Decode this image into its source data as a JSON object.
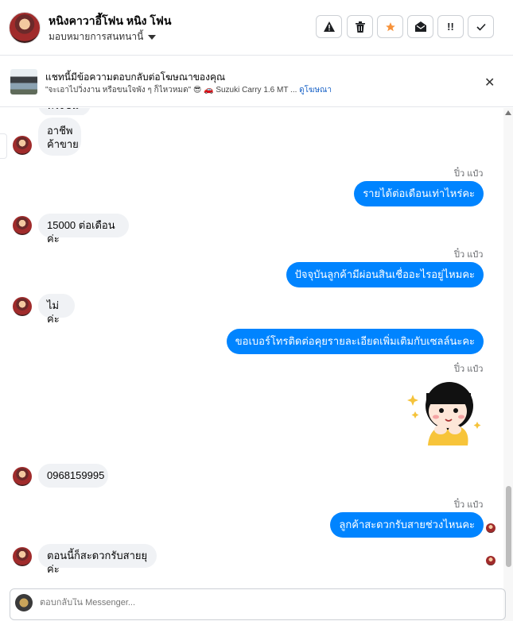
{
  "header": {
    "contact_name": "หนิงคาวาอี้โฟน หนิง โฟน",
    "assign_label": "มอบหมายการสนทนานี้",
    "tools": [
      {
        "icon": "warning-icon",
        "glyph": "⚠"
      },
      {
        "icon": "trash-icon",
        "glyph": "🗑"
      },
      {
        "icon": "star-icon",
        "glyph": "★"
      },
      {
        "icon": "envelope-open-icon",
        "glyph": "✉"
      },
      {
        "icon": "follow-up-icon",
        "glyph": "!!"
      },
      {
        "icon": "check-icon",
        "glyph": "✓"
      }
    ]
  },
  "ad_reply": {
    "title": "แชทนี้มีข้อความตอบกลับต่อโฆษณาของคุณ",
    "subtitle": "\"จะเอาไปวิ่งงาน หรือขนใจพัง ๆ ก็ไหวหมด\" 😎 🚗 Suzuki Carry 1.6 MT ...",
    "link": "ดูโฆษณา"
  },
  "messages": {
    "m_partial": "ทรงชนิ",
    "m1_line1": "อาชีพ",
    "m1_line2": "ค้าขาย",
    "sender_a": "ปิ๋ว แป๋ว",
    "m2": "รายได้ต่อเดือนเท่าไหร่คะ",
    "m3": "15000 ต่อเดือนค่ะ",
    "sender_b": "ปิ๋ว แป๋ว",
    "m4": "ปัจจุบันลูกค้ามีผ่อนสินเชื่ออะไรอยู่ไหมคะ",
    "m5": "ไม่ค่ะ",
    "m6": "ขอเบอร์โทรติดต่อคุยรายละเอียดเพิ่มเติมกับเซลล์นะคะ",
    "sender_c": "ปิ๋ว แป๋ว",
    "m7": "0968159995",
    "sender_d": "ปิ๋ว แป๋ว",
    "m8": "ลูกค้าสะดวกรับสายช่วงไหนคะ",
    "m9": "ตอนนี้ก็สะดวกรับสายยุค่ะ"
  },
  "composer": {
    "placeholder": "ตอบกลับใน Messenger..."
  },
  "colors": {
    "outgoing_bubble": "#0084ff",
    "incoming_bubble": "#f0f2f5",
    "star": "#f7923a"
  }
}
